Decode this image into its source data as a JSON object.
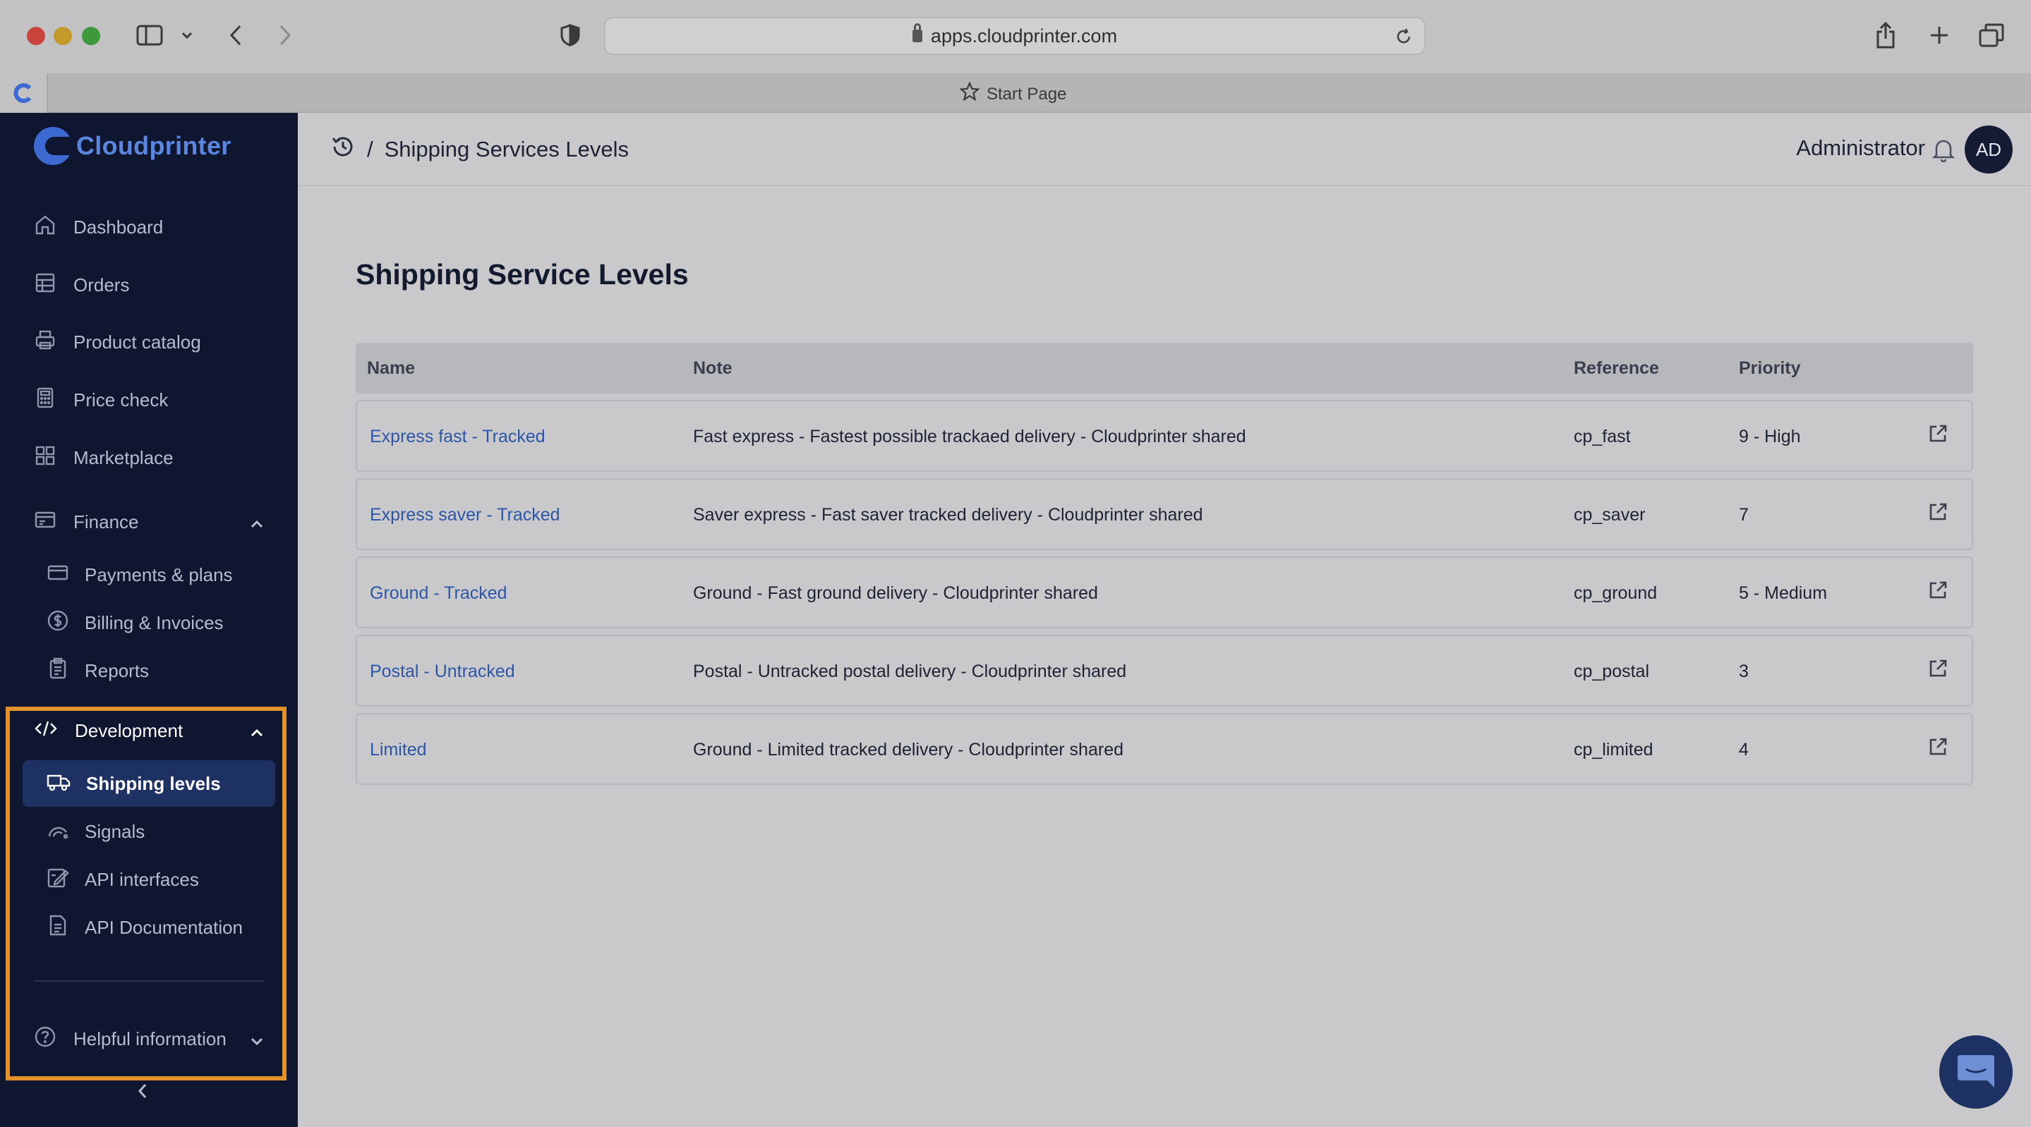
{
  "browser": {
    "url": "apps.cloudprinter.com",
    "tab_title": "Start Page"
  },
  "sidebar": {
    "logo_text": "Cloudprinter",
    "items": [
      {
        "label": "Dashboard",
        "icon": "home-icon"
      },
      {
        "label": "Orders",
        "icon": "orders-icon"
      },
      {
        "label": "Product catalog",
        "icon": "catalog-icon"
      },
      {
        "label": "Price check",
        "icon": "calculator-icon"
      },
      {
        "label": "Marketplace",
        "icon": "marketplace-icon"
      }
    ],
    "finance": {
      "label": "Finance",
      "children": [
        {
          "label": "Payments & plans",
          "icon": "card-icon"
        },
        {
          "label": "Billing & Invoices",
          "icon": "dollar-icon"
        },
        {
          "label": "Reports",
          "icon": "report-icon"
        }
      ]
    },
    "development": {
      "label": "Development",
      "children": [
        {
          "label": "Shipping levels",
          "icon": "truck-icon",
          "active": true
        },
        {
          "label": "Signals",
          "icon": "signal-icon"
        },
        {
          "label": "API interfaces",
          "icon": "api-icon"
        },
        {
          "label": "API Documentation",
          "icon": "doc-icon"
        }
      ]
    },
    "helpful": {
      "label": "Helpful information"
    }
  },
  "header": {
    "breadcrumb_sep": "/",
    "breadcrumb_title": "Shipping Services Levels",
    "user": "Administrator",
    "avatar_initials": "AD"
  },
  "main": {
    "title": "Shipping Service Levels",
    "columns": [
      "Name",
      "Note",
      "Reference",
      "Priority"
    ],
    "rows": [
      {
        "name": "Express fast - Tracked",
        "note": "Fast express - Fastest possible trackaed delivery - Cloudprinter shared",
        "reference": "cp_fast",
        "priority": "9 - High"
      },
      {
        "name": "Express saver - Tracked",
        "note": "Saver express - Fast saver tracked delivery - Cloudprinter shared",
        "reference": "cp_saver",
        "priority": "7"
      },
      {
        "name": "Ground - Tracked",
        "note": "Ground - Fast ground delivery - Cloudprinter shared",
        "reference": "cp_ground",
        "priority": "5 - Medium"
      },
      {
        "name": "Postal - Untracked",
        "note": "Postal - Untracked postal delivery - Cloudprinter shared",
        "reference": "cp_postal",
        "priority": "3"
      },
      {
        "name": "Limited",
        "note": "Ground - Limited tracked delivery - Cloudprinter shared",
        "reference": "cp_limited",
        "priority": "4"
      }
    ]
  },
  "colors": {
    "sidebar_bg": "#0f1730",
    "active_bg": "#1d3163",
    "highlight": "#e3922a",
    "link": "#2d56a8"
  }
}
